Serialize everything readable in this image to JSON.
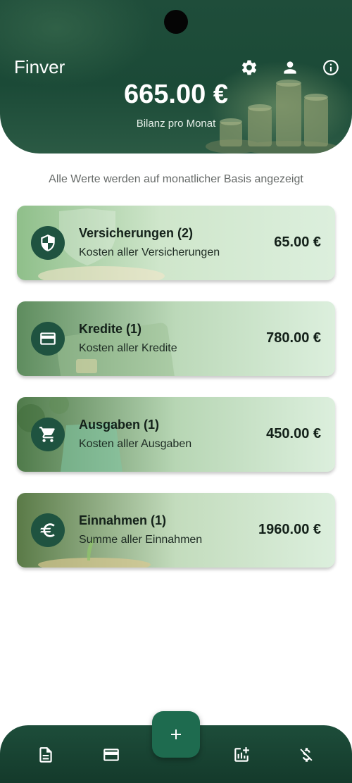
{
  "app": {
    "title": "Finver"
  },
  "header": {
    "balance": "665.00 €",
    "balance_label": "Bilanz pro Monat",
    "icons": [
      "settings-icon",
      "account-icon",
      "info-icon"
    ]
  },
  "info_text": "Alle Werte werden auf monatlicher Basis angezeigt",
  "cards": [
    {
      "title": "Versicherungen (2)",
      "subtitle": "Kosten aller Versicherungen",
      "amount": "65.00 €",
      "icon": "shield-icon"
    },
    {
      "title": "Kredite (1)",
      "subtitle": "Kosten aller Kredite",
      "amount": "780.00 €",
      "icon": "credit-card-icon"
    },
    {
      "title": "Ausgaben (1)",
      "subtitle": "Kosten aller Ausgaben",
      "amount": "450.00 €",
      "icon": "shopping-cart-icon"
    },
    {
      "title": "Einnahmen (1)",
      "subtitle": "Summe aller Einnahmen",
      "amount": "1960.00 €",
      "icon": "euro-icon"
    }
  ],
  "bottom_nav": {
    "items": [
      "document-icon",
      "credit-card-icon",
      "add-icon",
      "chart-add-icon",
      "money-off-icon"
    ]
  },
  "colors": {
    "header": "#1b4a37",
    "icon_circle": "#1f5340",
    "card_bg": "#dcefdd",
    "fab": "#1e6b4f"
  }
}
